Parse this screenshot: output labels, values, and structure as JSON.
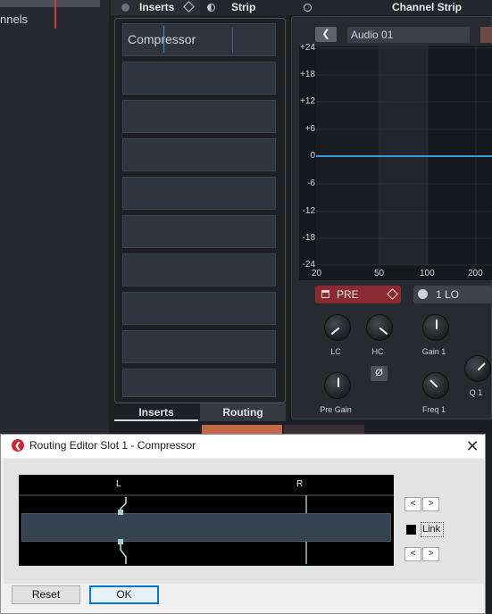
{
  "left_panel": {
    "label": "nnels"
  },
  "tabs": {
    "inserts": "Inserts",
    "strip": "Strip",
    "channel_strip": "Channel Strip"
  },
  "insert_slots": [
    {
      "name": "Compressor"
    },
    {
      "name": ""
    },
    {
      "name": ""
    },
    {
      "name": ""
    },
    {
      "name": ""
    },
    {
      "name": ""
    },
    {
      "name": ""
    },
    {
      "name": ""
    },
    {
      "name": ""
    },
    {
      "name": ""
    }
  ],
  "bottom_tabs": {
    "inserts": "Inserts",
    "routing": "Routing"
  },
  "eq": {
    "track_name": "Audio 01",
    "db_ticks": [
      "+24",
      "+18",
      "+12",
      "+6",
      "0",
      "-6",
      "-12",
      "-18",
      "-24"
    ],
    "hz_ticks": [
      "20",
      "50",
      "100",
      "200"
    ],
    "curve_color": "#3a9ad9",
    "pre_label": "PRE",
    "band_label": "1 LO",
    "knobs": {
      "lc": "LC",
      "hc": "HC",
      "pre_gain": "Pre Gain",
      "gain1": "Gain 1",
      "freq1": "Freq 1",
      "q1": "Q 1"
    },
    "phase_symbol": "Ø"
  },
  "dialog": {
    "title": "Routing Editor Slot 1 - Compressor",
    "close": "✕",
    "channels": {
      "left": "L",
      "right": "R"
    },
    "btn_left": "<",
    "btn_right": ">",
    "link_label": "Link",
    "reset": "Reset",
    "ok": "OK"
  }
}
